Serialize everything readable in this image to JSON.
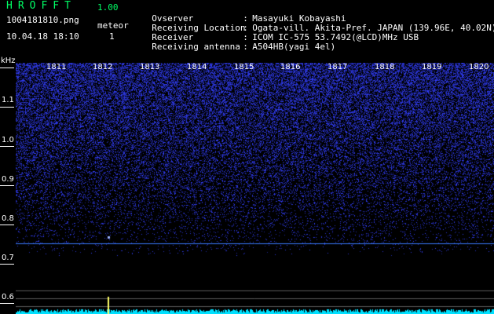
{
  "header": {
    "app_title": "HROFFT",
    "app_version": "1.00",
    "file_name": "1004181810.png",
    "datetime": "10.04.18 18:10",
    "meteor_label": "meteor",
    "meteor_count": "1",
    "info": [
      {
        "key": "Ovserver",
        "value": "Masayuki Kobayashi"
      },
      {
        "key": "Receiving Location",
        "value": "Ogata-vill. Akita-Pref. JAPAN (139.96E, 40.02N)"
      },
      {
        "key": "Receiver",
        "value": "ICOM IC-575 53.7492(@LCD)MHz USB"
      },
      {
        "key": "Receiving antenna",
        "value": "A504HB(yagi 4el)"
      }
    ]
  },
  "axis": {
    "unit": "kHz",
    "freq_labels": [
      "1.1",
      "1.0",
      "0.9",
      "0.8",
      "0.7",
      "0.6"
    ],
    "time_labels": [
      "1811",
      "1812",
      "1813",
      "1814",
      "1815",
      "1816",
      "1817",
      "1818",
      "1819",
      "1820"
    ]
  },
  "colors": {
    "noise": "#2a34ff",
    "carrier_line": "#3a7bff",
    "baseline": "#00e0ff",
    "meteor": "#ffff66",
    "grid": "#ffffff",
    "title_green": "#00ff66"
  }
}
